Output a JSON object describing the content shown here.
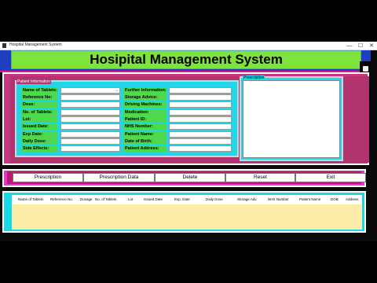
{
  "window": {
    "title": "Hospital Management System",
    "controls": [
      "—",
      "☐",
      "✕"
    ]
  },
  "header": {
    "title": "Hosipital Management System"
  },
  "patient_info": {
    "frame_label": "Patient Information",
    "left_fields": [
      "Name of Tablets:",
      "Reference No:",
      "Dose:",
      "No. of Tablets:",
      "Lot:",
      "Issued Date:",
      "Exp Date:",
      "Daily Dose:",
      "Side Effects:"
    ],
    "right_fields": [
      "Further Information:",
      "Storage Advice:",
      "Driving Machines:",
      "Medication:",
      "Patient ID:",
      "NHS Number:",
      "Patient Name:",
      "Date of Birth:",
      "Patient Address:"
    ],
    "tablet_dropdown_arrow": "⌄"
  },
  "prescription": {
    "frame_label": "Prescription",
    "text": ""
  },
  "buttons": {
    "prescription": "Prescription",
    "prescription_data": "Prescription Data",
    "delete": "Delete",
    "reset": "Reset",
    "exit": "Exit"
  },
  "table": {
    "columns": [
      "Name of Tablets",
      "Reference No.",
      "Dosage",
      "No. of Tablets",
      "Lot",
      "Issued Date",
      "Exp. Date",
      "Daily Dose",
      "Storage Adv.",
      "NHS Number",
      "Patient Name",
      "DOB",
      "Address"
    ],
    "rows": []
  },
  "colors": {
    "header_bg": "#7ee33a",
    "frame_magenta": "#c8377e",
    "patient_bg": "#20d7e9",
    "label_green": "#4ed84b",
    "table_bg": "#fdeca8"
  }
}
